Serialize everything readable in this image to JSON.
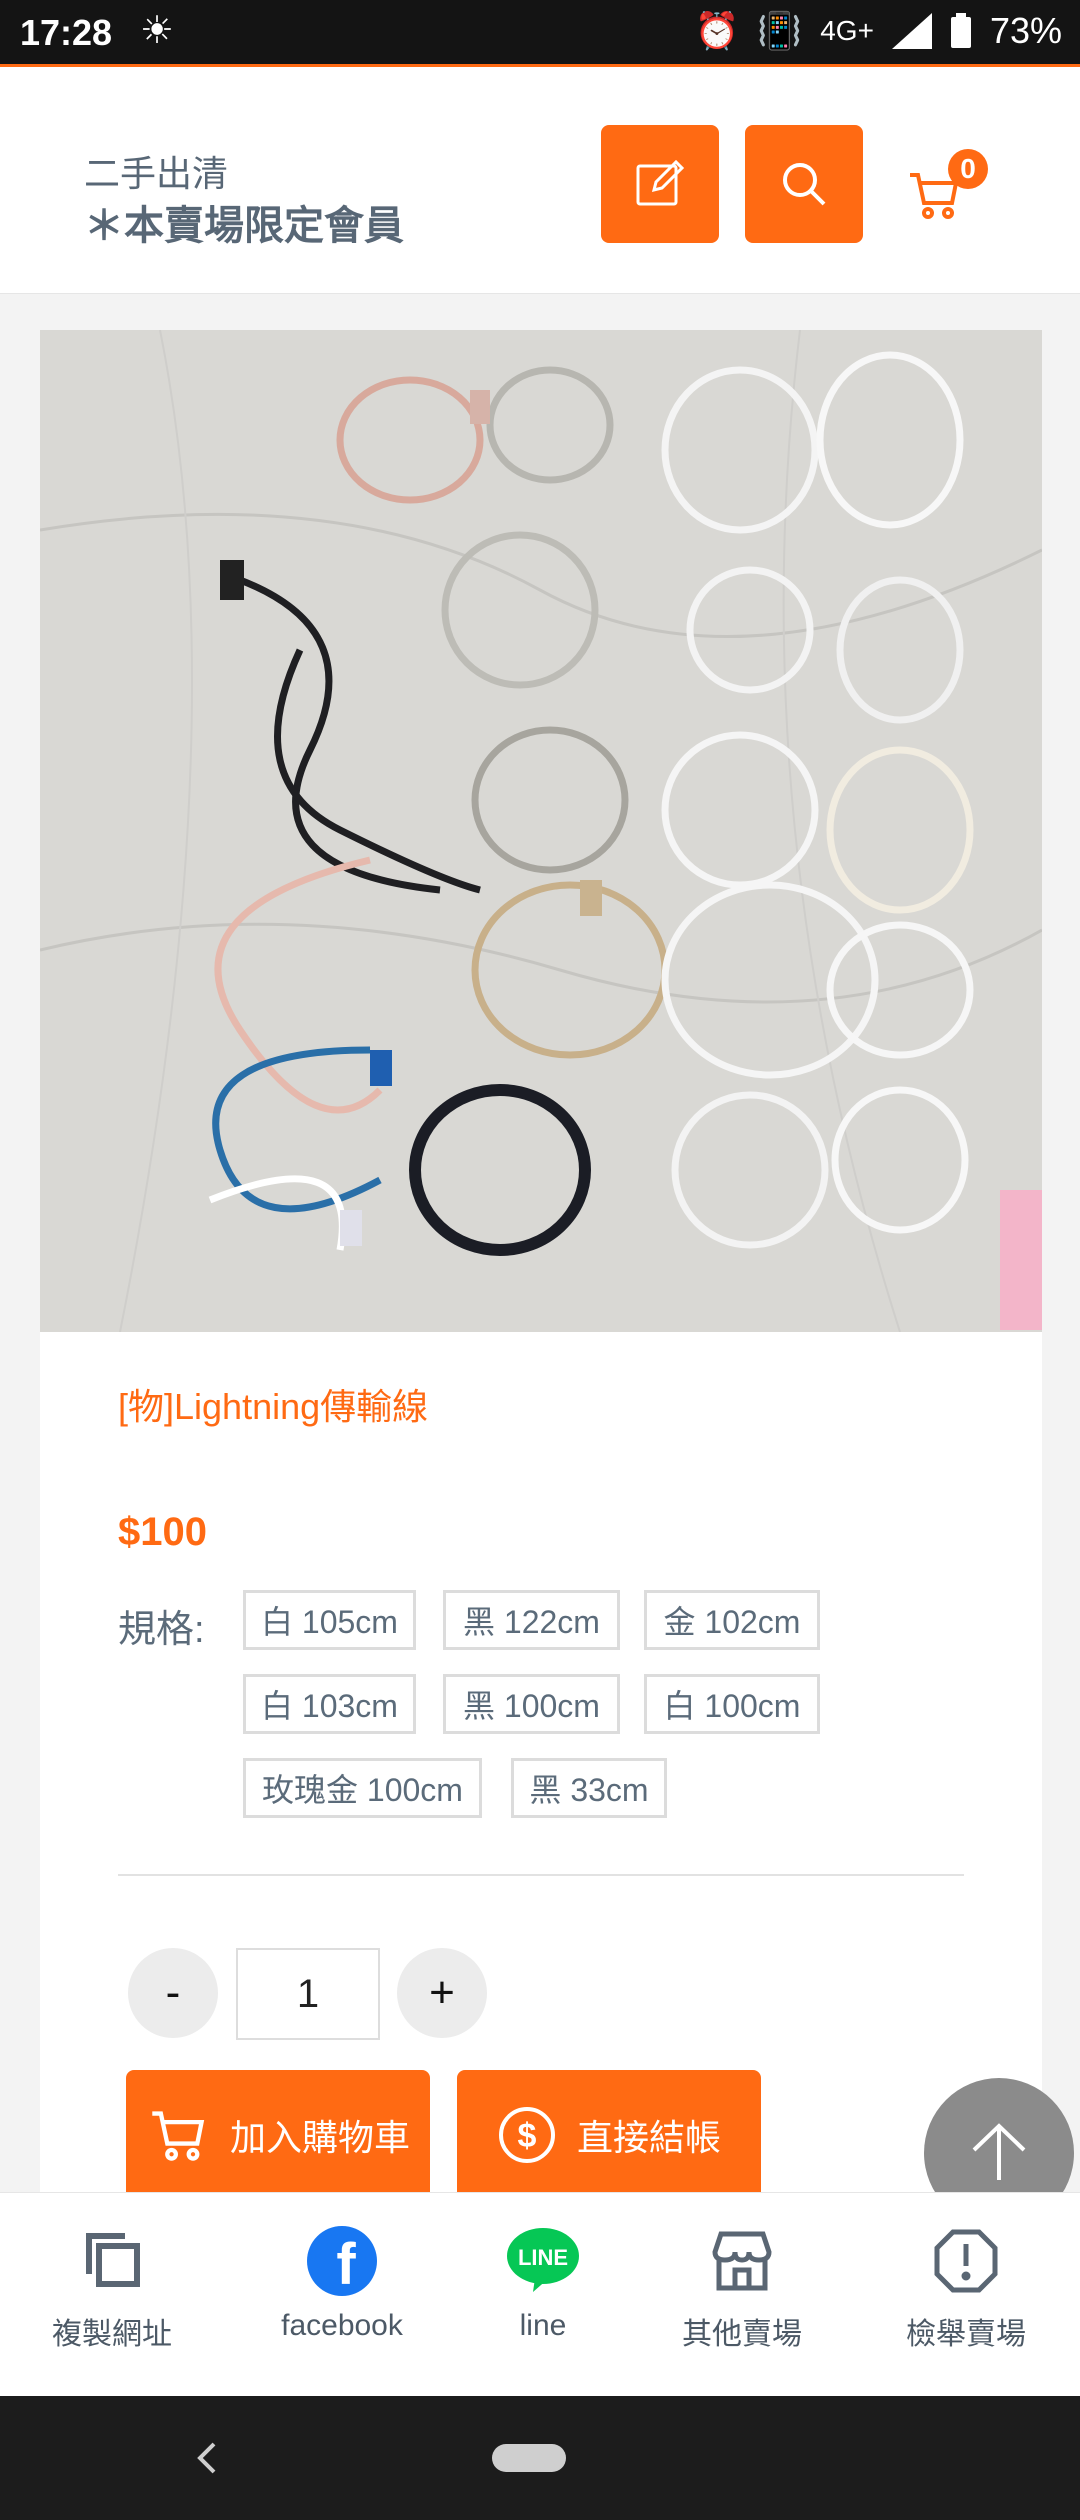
{
  "status_bar": {
    "time": "17:28",
    "network": "4G+",
    "battery": "73%"
  },
  "header": {
    "store_title": "二手出清",
    "store_subtitle": "＊本賣場限定會員",
    "cart_count": "0"
  },
  "product": {
    "title": "[物]Lightning傳輸線",
    "price": "$100",
    "spec_label": "規格:",
    "specs": [
      "白 105cm",
      "黑 122cm",
      "金 102cm",
      "白 103cm",
      "黑 100cm",
      "白 100cm",
      "玫瑰金 100cm",
      "黑 33cm"
    ],
    "quantity": "1",
    "minus_label": "-",
    "plus_label": "+",
    "add_to_cart_label": "加入購物車",
    "checkout_label": "直接結帳"
  },
  "bottom_nav": {
    "copy_url": "複製網址",
    "facebook": "facebook",
    "line": "line",
    "line_logo": "LINE",
    "other_stores": "其他賣場",
    "report_store": "檢舉賣場"
  },
  "colors": {
    "accent": "#ff6a13",
    "text_muted": "#5b6b7a"
  }
}
